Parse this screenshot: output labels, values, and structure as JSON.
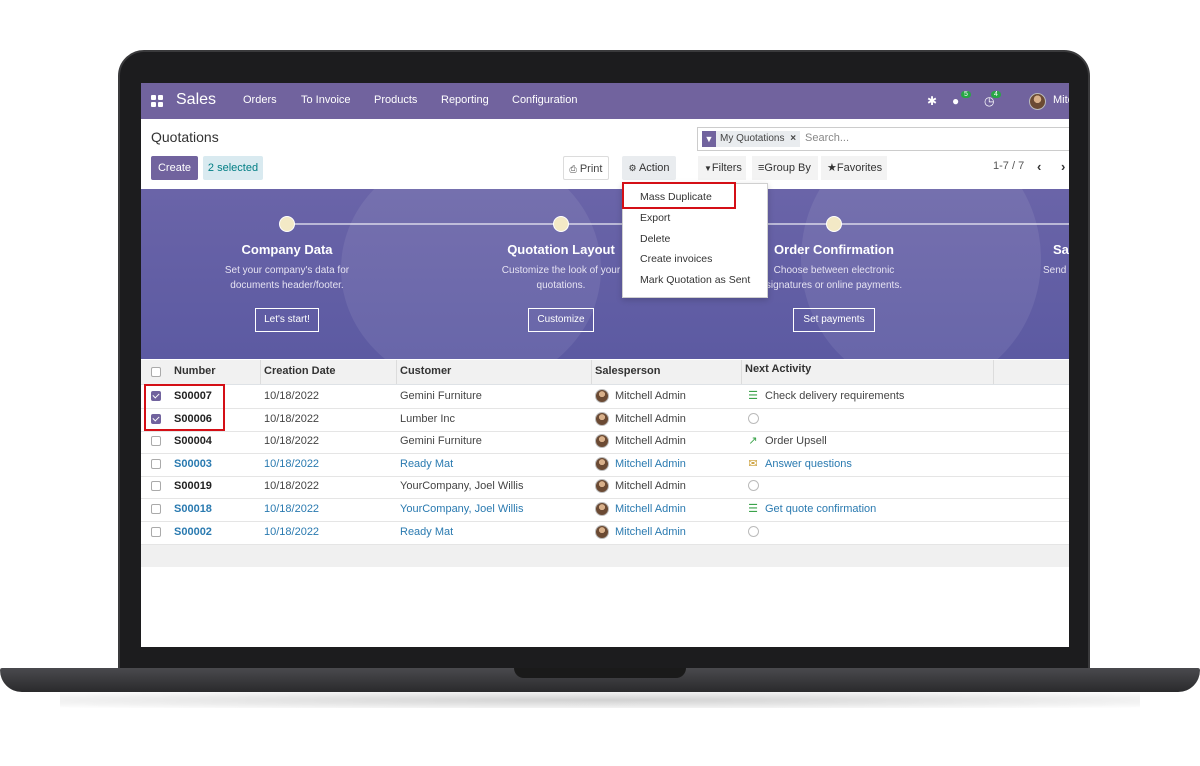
{
  "navbar": {
    "app_name": "Sales",
    "menu": [
      "Orders",
      "To Invoice",
      "Products",
      "Reporting",
      "Configuration"
    ],
    "messages_badge": "5",
    "activities_badge": "4",
    "user_name": "Mitc",
    "color": "#71639e"
  },
  "control_panel": {
    "title": "Quotations",
    "create_label": "Create",
    "selected_label": "2 selected",
    "print_label": "Print",
    "action_label": "Action",
    "search_facet": "My Quotations",
    "search_placeholder": "Search...",
    "filters_label": "Filters",
    "groupby_label": "Group By",
    "favorites_label": "Favorites",
    "pager": "1-7 / 7"
  },
  "action_menu": [
    "Mass Duplicate",
    "Export",
    "Delete",
    "Create invoices",
    "Mark Quotation as Sent"
  ],
  "banner": {
    "steps": [
      {
        "title": "Company Data",
        "desc1": "Set your company's data for",
        "desc2": "documents header/footer.",
        "button": "Let's start!"
      },
      {
        "title": "Quotation Layout",
        "desc1": "Customize the look of your",
        "desc2": "quotations.",
        "button": "Customize"
      },
      {
        "title": "Order Confirmation",
        "desc1": "Choose between electronic",
        "desc2": "signatures or online payments.",
        "button": "Set payments"
      },
      {
        "title": "Sa",
        "desc1": "Send",
        "desc2": "",
        "button": ""
      }
    ]
  },
  "table": {
    "headers": [
      "Number",
      "Creation Date",
      "Customer",
      "Salesperson",
      "Next Activity"
    ],
    "rows": [
      {
        "number": "S00007",
        "date": "10/18/2022",
        "customer": "Gemini Furniture",
        "salesperson": "Mitchell Admin",
        "activity": "Check delivery requirements",
        "activity_icon": "todo-icon",
        "checked": true,
        "link": false
      },
      {
        "number": "S00006",
        "date": "10/18/2022",
        "customer": "Lumber Inc",
        "salesperson": "Mitchell Admin",
        "activity": "",
        "activity_icon": "clock-icon",
        "checked": true,
        "link": false
      },
      {
        "number": "S00004",
        "date": "10/18/2022",
        "customer": "Gemini Furniture",
        "salesperson": "Mitchell Admin",
        "activity": "Order Upsell",
        "activity_icon": "upsell-chart-icon",
        "checked": false,
        "link": false
      },
      {
        "number": "S00003",
        "date": "10/18/2022",
        "customer": "Ready Mat",
        "salesperson": "Mitchell Admin",
        "activity": "Answer questions",
        "activity_icon": "envelope-icon",
        "checked": false,
        "link": true
      },
      {
        "number": "S00019",
        "date": "10/18/2022",
        "customer": "YourCompany, Joel Willis",
        "salesperson": "Mitchell Admin",
        "activity": "",
        "activity_icon": "clock-icon",
        "checked": false,
        "link": false
      },
      {
        "number": "S00018",
        "date": "10/18/2022",
        "customer": "YourCompany, Joel Willis",
        "salesperson": "Mitchell Admin",
        "activity": "Get quote confirmation",
        "activity_icon": "todo-icon",
        "checked": false,
        "link": true
      },
      {
        "number": "S00002",
        "date": "10/18/2022",
        "customer": "Ready Mat",
        "salesperson": "Mitchell Admin",
        "activity": "",
        "activity_icon": "clock-icon",
        "checked": false,
        "link": true
      }
    ]
  }
}
